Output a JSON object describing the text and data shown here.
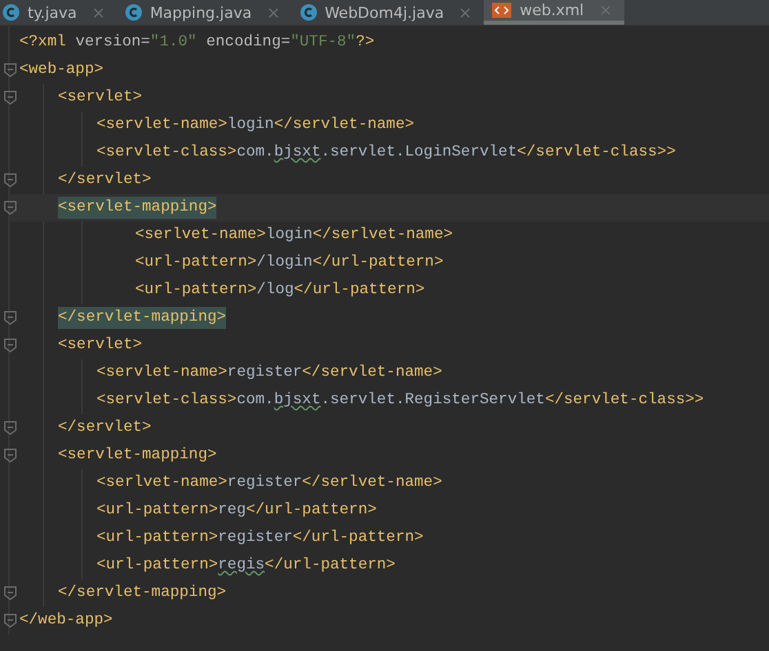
{
  "tabs": [
    {
      "label": "ty.java",
      "kind": "java",
      "selected": false
    },
    {
      "label": "Mapping.java",
      "kind": "java",
      "selected": false
    },
    {
      "label": "WebDom4j.java",
      "kind": "java",
      "selected": false
    },
    {
      "label": "web.xml",
      "kind": "xml",
      "selected": true
    }
  ],
  "editor": {
    "nodes": [
      {
        "tokens": [
          {
            "kind": "tag",
            "text": "<?xml "
          },
          {
            "kind": "attr",
            "text": "version="
          },
          {
            "kind": "value",
            "text": "\"1.0\" "
          },
          {
            "kind": "attr",
            "text": "encoding="
          },
          {
            "kind": "value",
            "text": "\"UTF-8\""
          },
          {
            "kind": "tag",
            "text": "?>"
          }
        ]
      },
      {
        "open": [
          {
            "kind": "tag",
            "text": "<web-app>"
          }
        ],
        "close": [
          {
            "kind": "tag",
            "text": "</web-app>"
          }
        ],
        "children": [
          {
            "open": [
              {
                "kind": "tag",
                "text": "<servlet>"
              }
            ],
            "close": [
              {
                "kind": "tag",
                "text": "</servlet>"
              }
            ],
            "children": [
              {
                "tokens": [
                  {
                    "kind": "tag",
                    "text": "<servlet-name>"
                  },
                  {
                    "kind": "text",
                    "text": "login"
                  },
                  {
                    "kind": "tag",
                    "text": "</servlet-name>"
                  }
                ]
              },
              {
                "tokens": [
                  {
                    "kind": "tag",
                    "text": "<servlet-class>"
                  },
                  {
                    "kind": "text",
                    "text": "com."
                  },
                  {
                    "kind": "typo",
                    "text": "bjsxt"
                  },
                  {
                    "kind": "text",
                    "text": ".servlet.LoginServlet"
                  },
                  {
                    "kind": "tag",
                    "text": "</servlet-class>>"
                  }
                ]
              }
            ]
          },
          {
            "matched": true,
            "tabbed": true,
            "open": [
              {
                "kind": "tag",
                "text": "<servlet-mapping>"
              }
            ],
            "close": [
              {
                "kind": "tag",
                "text": "</servlet-mapping>"
              }
            ],
            "children": [
              {
                "tokens": [
                  {
                    "kind": "tag",
                    "text": "<serlvet-name>"
                  },
                  {
                    "kind": "text",
                    "text": "login"
                  },
                  {
                    "kind": "tag",
                    "text": "</serlvet-name>"
                  }
                ]
              },
              {
                "tokens": [
                  {
                    "kind": "tag",
                    "text": "<url-pattern>"
                  },
                  {
                    "kind": "text",
                    "text": "/login"
                  },
                  {
                    "kind": "tag",
                    "text": "</url-pattern>"
                  }
                ]
              },
              {
                "tokens": [
                  {
                    "kind": "tag",
                    "text": "<url-pattern>"
                  },
                  {
                    "kind": "text",
                    "text": "/log"
                  },
                  {
                    "kind": "tag",
                    "text": "</url-pattern>"
                  }
                ]
              }
            ]
          },
          {
            "open": [
              {
                "kind": "tag",
                "text": "<servlet>"
              }
            ],
            "close": [
              {
                "kind": "tag",
                "text": "</servlet>"
              }
            ],
            "children": [
              {
                "tokens": [
                  {
                    "kind": "tag",
                    "text": "<servlet-name>"
                  },
                  {
                    "kind": "text",
                    "text": "register"
                  },
                  {
                    "kind": "tag",
                    "text": "</servlet-name>"
                  }
                ]
              },
              {
                "tokens": [
                  {
                    "kind": "tag",
                    "text": "<servlet-class>"
                  },
                  {
                    "kind": "text",
                    "text": "com."
                  },
                  {
                    "kind": "typo",
                    "text": "bjsxt"
                  },
                  {
                    "kind": "text",
                    "text": ".servlet.RegisterServlet"
                  },
                  {
                    "kind": "tag",
                    "text": "</servlet-class>>"
                  }
                ]
              }
            ]
          },
          {
            "open": [
              {
                "kind": "tag",
                "text": "<servlet-mapping>"
              }
            ],
            "close": [
              {
                "kind": "tag",
                "text": "</servlet-mapping>"
              }
            ],
            "children": [
              {
                "tokens": [
                  {
                    "kind": "tag",
                    "text": "<serlvet-name>"
                  },
                  {
                    "kind": "text",
                    "text": "register"
                  },
                  {
                    "kind": "tag",
                    "text": "</serlvet-name>"
                  }
                ]
              },
              {
                "tokens": [
                  {
                    "kind": "tag",
                    "text": "<url-pattern>"
                  },
                  {
                    "kind": "text",
                    "text": "reg"
                  },
                  {
                    "kind": "tag",
                    "text": "</url-pattern>"
                  }
                ]
              },
              {
                "tokens": [
                  {
                    "kind": "tag",
                    "text": "<url-pattern>"
                  },
                  {
                    "kind": "text",
                    "text": "register"
                  },
                  {
                    "kind": "tag",
                    "text": "</url-pattern>"
                  }
                ]
              },
              {
                "tokens": [
                  {
                    "kind": "tag",
                    "text": "<url-pattern>"
                  },
                  {
                    "kind": "typo",
                    "text": "regis"
                  },
                  {
                    "kind": "tag",
                    "text": "</url-pattern>"
                  }
                ]
              }
            ]
          }
        ]
      }
    ]
  }
}
